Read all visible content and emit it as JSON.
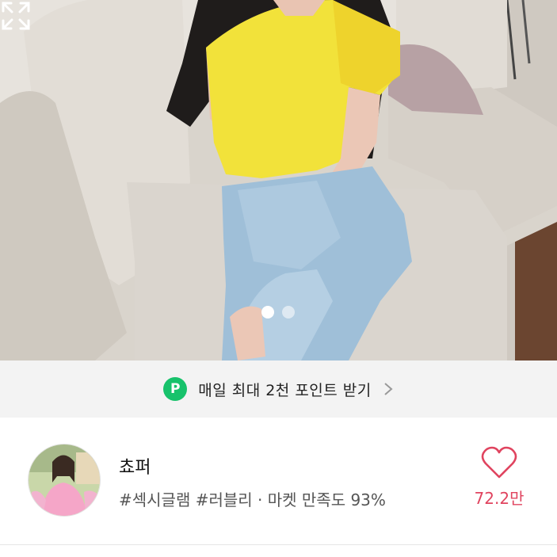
{
  "product_image": {
    "dots": [
      "slide-1",
      "slide-2"
    ],
    "active_index": 0
  },
  "points_banner": {
    "badge": "P",
    "text": "매일 최대 2천 포인트 받기"
  },
  "shop": {
    "name": "쵸퍼",
    "tags": "#섹시글램 #러블리 · 마켓 만족도 93%",
    "like_count": "72.2만"
  },
  "colors": {
    "accent": "#e0445f",
    "point_green": "#17c26b",
    "banner_bg": "#f3f3f3"
  }
}
